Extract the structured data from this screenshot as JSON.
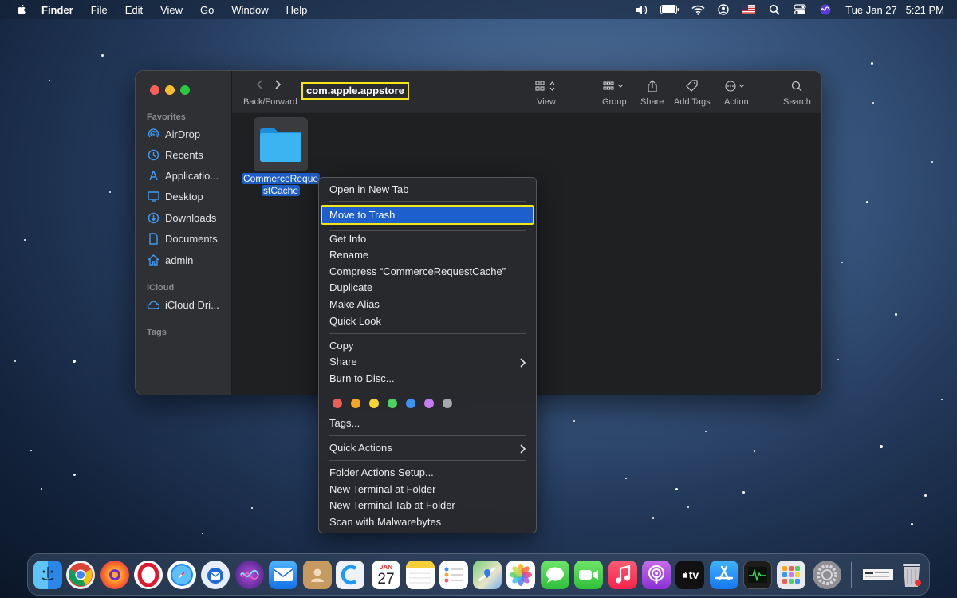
{
  "menubar": {
    "items": [
      "Finder",
      "File",
      "Edit",
      "View",
      "Go",
      "Window",
      "Help"
    ],
    "clock": "Tue Jan 27   5:21 PM"
  },
  "sidebar": {
    "favorites_header": "Favorites",
    "favorites": [
      {
        "label": "AirDrop",
        "icon": "airdrop-icon"
      },
      {
        "label": "Recents",
        "icon": "clock-icon"
      },
      {
        "label": "Applicatio...",
        "icon": "applications-icon"
      },
      {
        "label": "Desktop",
        "icon": "desktop-icon"
      },
      {
        "label": "Downloads",
        "icon": "downloads-icon"
      },
      {
        "label": "Documents",
        "icon": "document-icon"
      },
      {
        "label": "admin",
        "icon": "home-icon"
      }
    ],
    "icloud_header": "iCloud",
    "icloud": [
      {
        "label": "iCloud Dri...",
        "icon": "cloud-icon"
      }
    ],
    "tags_header": "Tags"
  },
  "toolbar": {
    "back_forward_label": "Back/Forward",
    "path_title": "com.apple.appstore",
    "buttons": [
      {
        "label": "View",
        "icon": "icon-grid-icon"
      },
      {
        "label": "Group",
        "icon": "group-icon"
      },
      {
        "label": "Share",
        "icon": "share-icon"
      },
      {
        "label": "Add Tags",
        "icon": "tag-icon"
      },
      {
        "label": "Action",
        "icon": "ellipsis-icon"
      },
      {
        "label": "Search",
        "icon": "search-icon"
      }
    ]
  },
  "content": {
    "folder_name_line1": "CommerceReque",
    "folder_name_line2": "stCache"
  },
  "context_menu": {
    "open_new_tab": "Open in New Tab",
    "move_to_trash": "Move to Trash",
    "get_info": "Get Info",
    "rename": "Rename",
    "compress": "Compress “CommerceRequestCache”",
    "duplicate": "Duplicate",
    "make_alias": "Make Alias",
    "quick_look": "Quick Look",
    "copy": "Copy",
    "share": "Share",
    "burn": "Burn to Disc...",
    "tag_colors": [
      "#ec5f59",
      "#f5a623",
      "#f8d531",
      "#4dd163",
      "#3b93f5",
      "#c57cf0",
      "#a7a7ab"
    ],
    "tags": "Tags...",
    "quick_actions": "Quick Actions",
    "folder_actions": "Folder Actions Setup...",
    "new_terminal": "New Terminal at Folder",
    "new_terminal_tab": "New Terminal Tab at Folder",
    "scan_malwarebytes": "Scan with Malwarebytes"
  },
  "dock": {
    "calendar_month": "JAN",
    "calendar_day": "27",
    "tv_label": "tv"
  },
  "colors": {
    "highlight": "#1e5fce",
    "annotation_outline": "#f5e61a"
  }
}
